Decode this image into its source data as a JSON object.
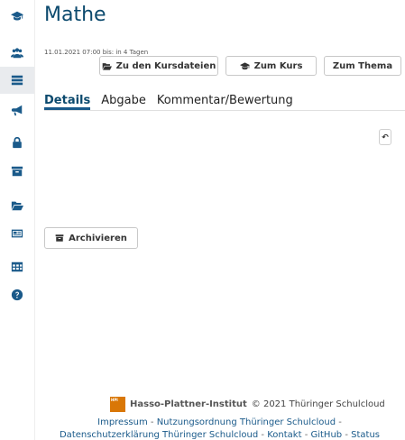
{
  "sidebar": {
    "items": [
      {
        "name": "graduation-cap-icon",
        "active": false
      },
      {
        "name": "users-icon",
        "active": false
      },
      {
        "name": "tasks-icon",
        "active": true
      },
      {
        "name": "bullhorn-icon",
        "active": false
      },
      {
        "name": "lock-icon",
        "active": false
      },
      {
        "name": "archive-icon",
        "active": false
      },
      {
        "name": "folder-open-icon",
        "active": false
      },
      {
        "name": "newspaper-icon",
        "active": false
      },
      {
        "name": "table-icon",
        "active": false
      },
      {
        "name": "question-circle-icon",
        "active": false
      }
    ]
  },
  "header": {
    "title": "Mathe",
    "meta": "11.01.2021 07:00 bis: in 4 Tagen"
  },
  "actions": {
    "files_label": "Zu den Kursdateien",
    "course_label": "Zum Kurs",
    "topic_label": "Zum Thema"
  },
  "tabs": [
    "Details",
    "Abgabe",
    "Kommentar/Bewertung"
  ],
  "side_button": "↶",
  "archive_label": "Archivieren",
  "footer": {
    "org": "Hasso-Plattner-Institut",
    "logo_text": "HPI",
    "copyright": "© 2021 Thüringer Schulcloud",
    "links_row1": [
      "Impressum",
      "Nutzungsordnung Thüringer Schulcloud",
      ""
    ],
    "links_row2": [
      "Datenschutzerklärung Thüringer Schulcloud",
      "Kontakt",
      "GitHub",
      "Status"
    ]
  },
  "colors": {
    "primary": "#0c4a6e",
    "icon": "#1a5a8a",
    "active_bg": "#e9ebee",
    "hpi_orange": "#d97706"
  }
}
